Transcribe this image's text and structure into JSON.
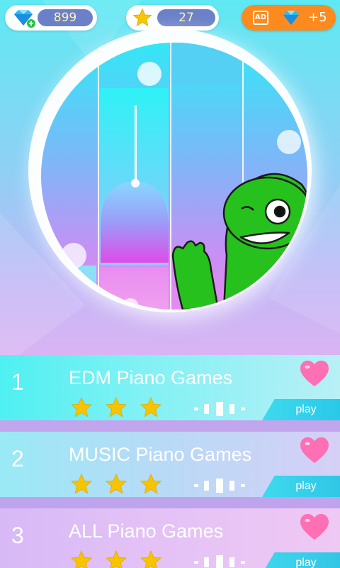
{
  "top_bar": {
    "gems": {
      "value": "899",
      "icon": "diamond-plus-icon"
    },
    "stars": {
      "value": "27",
      "icon": "star-icon"
    },
    "ad_reward": {
      "ad_label": "AD",
      "icon": "diamond-icon",
      "reward": "+5"
    }
  },
  "hero": {
    "scene": "piano-tiles-with-green-monster"
  },
  "songs": [
    {
      "number": "1",
      "title": "EDM Piano Games",
      "stars": 3,
      "play_label": "play"
    },
    {
      "number": "2",
      "title": "MUSIC Piano Games",
      "stars": 3,
      "play_label": "play"
    },
    {
      "number": "3",
      "title": "ALL Piano Games",
      "stars": 3,
      "play_label": "play"
    }
  ],
  "colors": {
    "star": "#f7c500",
    "heart": "#ff6fb4",
    "pill_inner": "#6b80c8",
    "ad_orange": "#fc8a1e",
    "play_cyan": "#2fcde8"
  }
}
